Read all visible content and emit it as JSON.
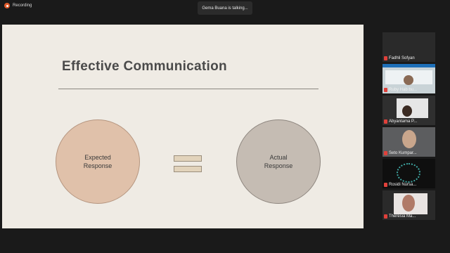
{
  "recording": {
    "label": "Recording",
    "color": "#e05a2b"
  },
  "talking_indicator": "Gema Buana is talking...",
  "slide": {
    "title": "Effective Communication",
    "left_circle": {
      "line1": "Expected",
      "line2": "Response",
      "color": "#e0c1aa"
    },
    "right_circle": {
      "line1": "Actual",
      "line2": "Response",
      "color": "#c5bcb3"
    }
  },
  "participants": [
    {
      "name": "Fadhli Sofyan",
      "muted": true
    },
    {
      "name": "Ruby Hab bu...",
      "muted": true
    },
    {
      "name": "Abyantama P...",
      "muted": true
    },
    {
      "name": "Seto Kumpar...",
      "muted": true
    },
    {
      "name": "Rosidi Nursa...",
      "muted": true
    },
    {
      "name": "Theresia Ma...",
      "muted": true
    }
  ],
  "icons": {
    "recording": "record-dot-icon",
    "mute": "mic-off-icon"
  }
}
